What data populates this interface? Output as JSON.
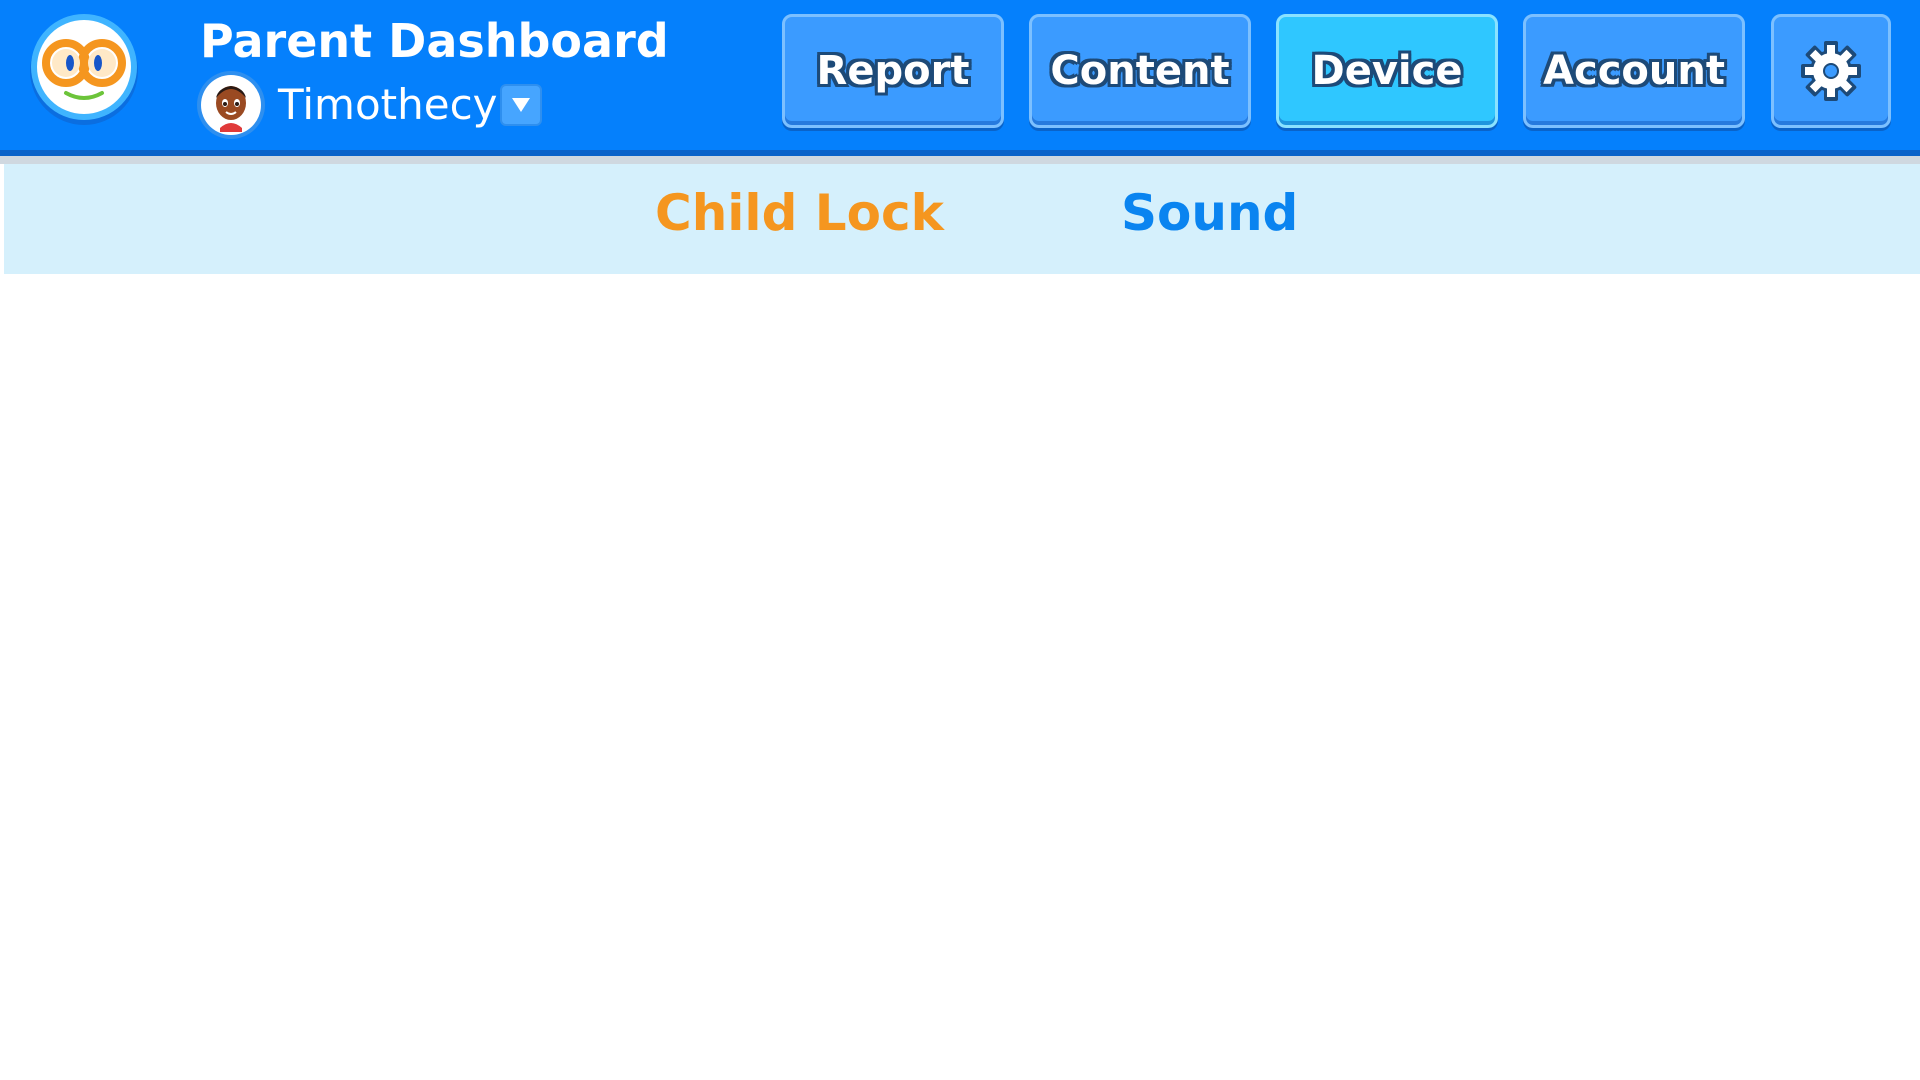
{
  "header": {
    "title": "Parent Dashboard",
    "child_name": "Timothecy",
    "logo_icon": "owl-logo-icon",
    "avatar_icon": "child-avatar-icon",
    "dropdown_icon": "triangle-down-icon"
  },
  "nav": {
    "buttons": [
      {
        "label": "Report",
        "active": false
      },
      {
        "label": "Content",
        "active": false
      },
      {
        "label": "Device",
        "active": true
      },
      {
        "label": "Account",
        "active": false
      }
    ],
    "settings_icon": "gear-icon"
  },
  "subnav": {
    "tabs": [
      {
        "label": "Child Lock",
        "active": true
      },
      {
        "label": "Sound",
        "active": false
      }
    ]
  },
  "colors": {
    "header_bg": "#0580fc",
    "active_nav": "#2fc7ff",
    "active_subtab": "#f5961f",
    "inactive_subtab": "#0a84f0",
    "subnav_bg": "#d5f0fc"
  }
}
